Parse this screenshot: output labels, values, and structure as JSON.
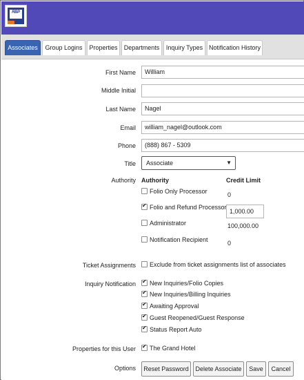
{
  "logo": {
    "text": "RBP"
  },
  "tabs": [
    {
      "label": "Associates",
      "active": true
    },
    {
      "label": "Group Logins"
    },
    {
      "label": "Properties"
    },
    {
      "label": "Departments"
    },
    {
      "label": "Inquiry Types"
    },
    {
      "label": "Notification History"
    }
  ],
  "form": {
    "first_name": {
      "label": "First Name",
      "value": "William"
    },
    "middle_initial": {
      "label": "Middle Initial",
      "value": ""
    },
    "last_name": {
      "label": "Last Name",
      "value": "Nagel"
    },
    "email": {
      "label": "Email",
      "value": "william_nagel@outlook.com"
    },
    "phone": {
      "label": "Phone",
      "value": "(888) 867 - 5309"
    },
    "title": {
      "label": "Title",
      "value": "Associate"
    }
  },
  "authority": {
    "label": "Authority",
    "col_authority": "Authority",
    "col_credit": "Credit Limit",
    "rows": [
      {
        "label": "Folio Only Processor",
        "checked": false,
        "credit": "0"
      },
      {
        "label": "Folio and Refund Processor",
        "checked": true,
        "credit": "1,000.00"
      },
      {
        "label": "Administrator",
        "checked": false,
        "credit": "100,000.00"
      },
      {
        "label": "Notification Recipient",
        "checked": false,
        "credit": "0"
      }
    ]
  },
  "ticket_assignments": {
    "label": "Ticket Assignments",
    "option": "Exclude from ticket assignments list of associates",
    "checked": false
  },
  "inquiry_notification": {
    "label": "Inquiry Notification",
    "options": [
      {
        "label": "New Inquiries/Folio Copies",
        "checked": true
      },
      {
        "label": "New Inquiries/Billing Inquiries",
        "checked": true
      },
      {
        "label": "Awaiting Approval",
        "checked": true
      },
      {
        "label": "Guest Reopened/Guest Response",
        "checked": true
      },
      {
        "label": "Status Report Auto",
        "checked": true
      }
    ]
  },
  "properties": {
    "label": "Properties for this User",
    "option": "The Grand Hotel",
    "checked": true
  },
  "options": {
    "label": "Options",
    "reset_password": "Reset Password",
    "delete_associate": "Delete Associate",
    "save": "Save",
    "cancel": "Cancel"
  },
  "colors": {
    "header": "#5249b9",
    "active_tab": "#3b64b0",
    "logo_blue": "#2b3f86",
    "logo_orange": "#e5732a"
  }
}
